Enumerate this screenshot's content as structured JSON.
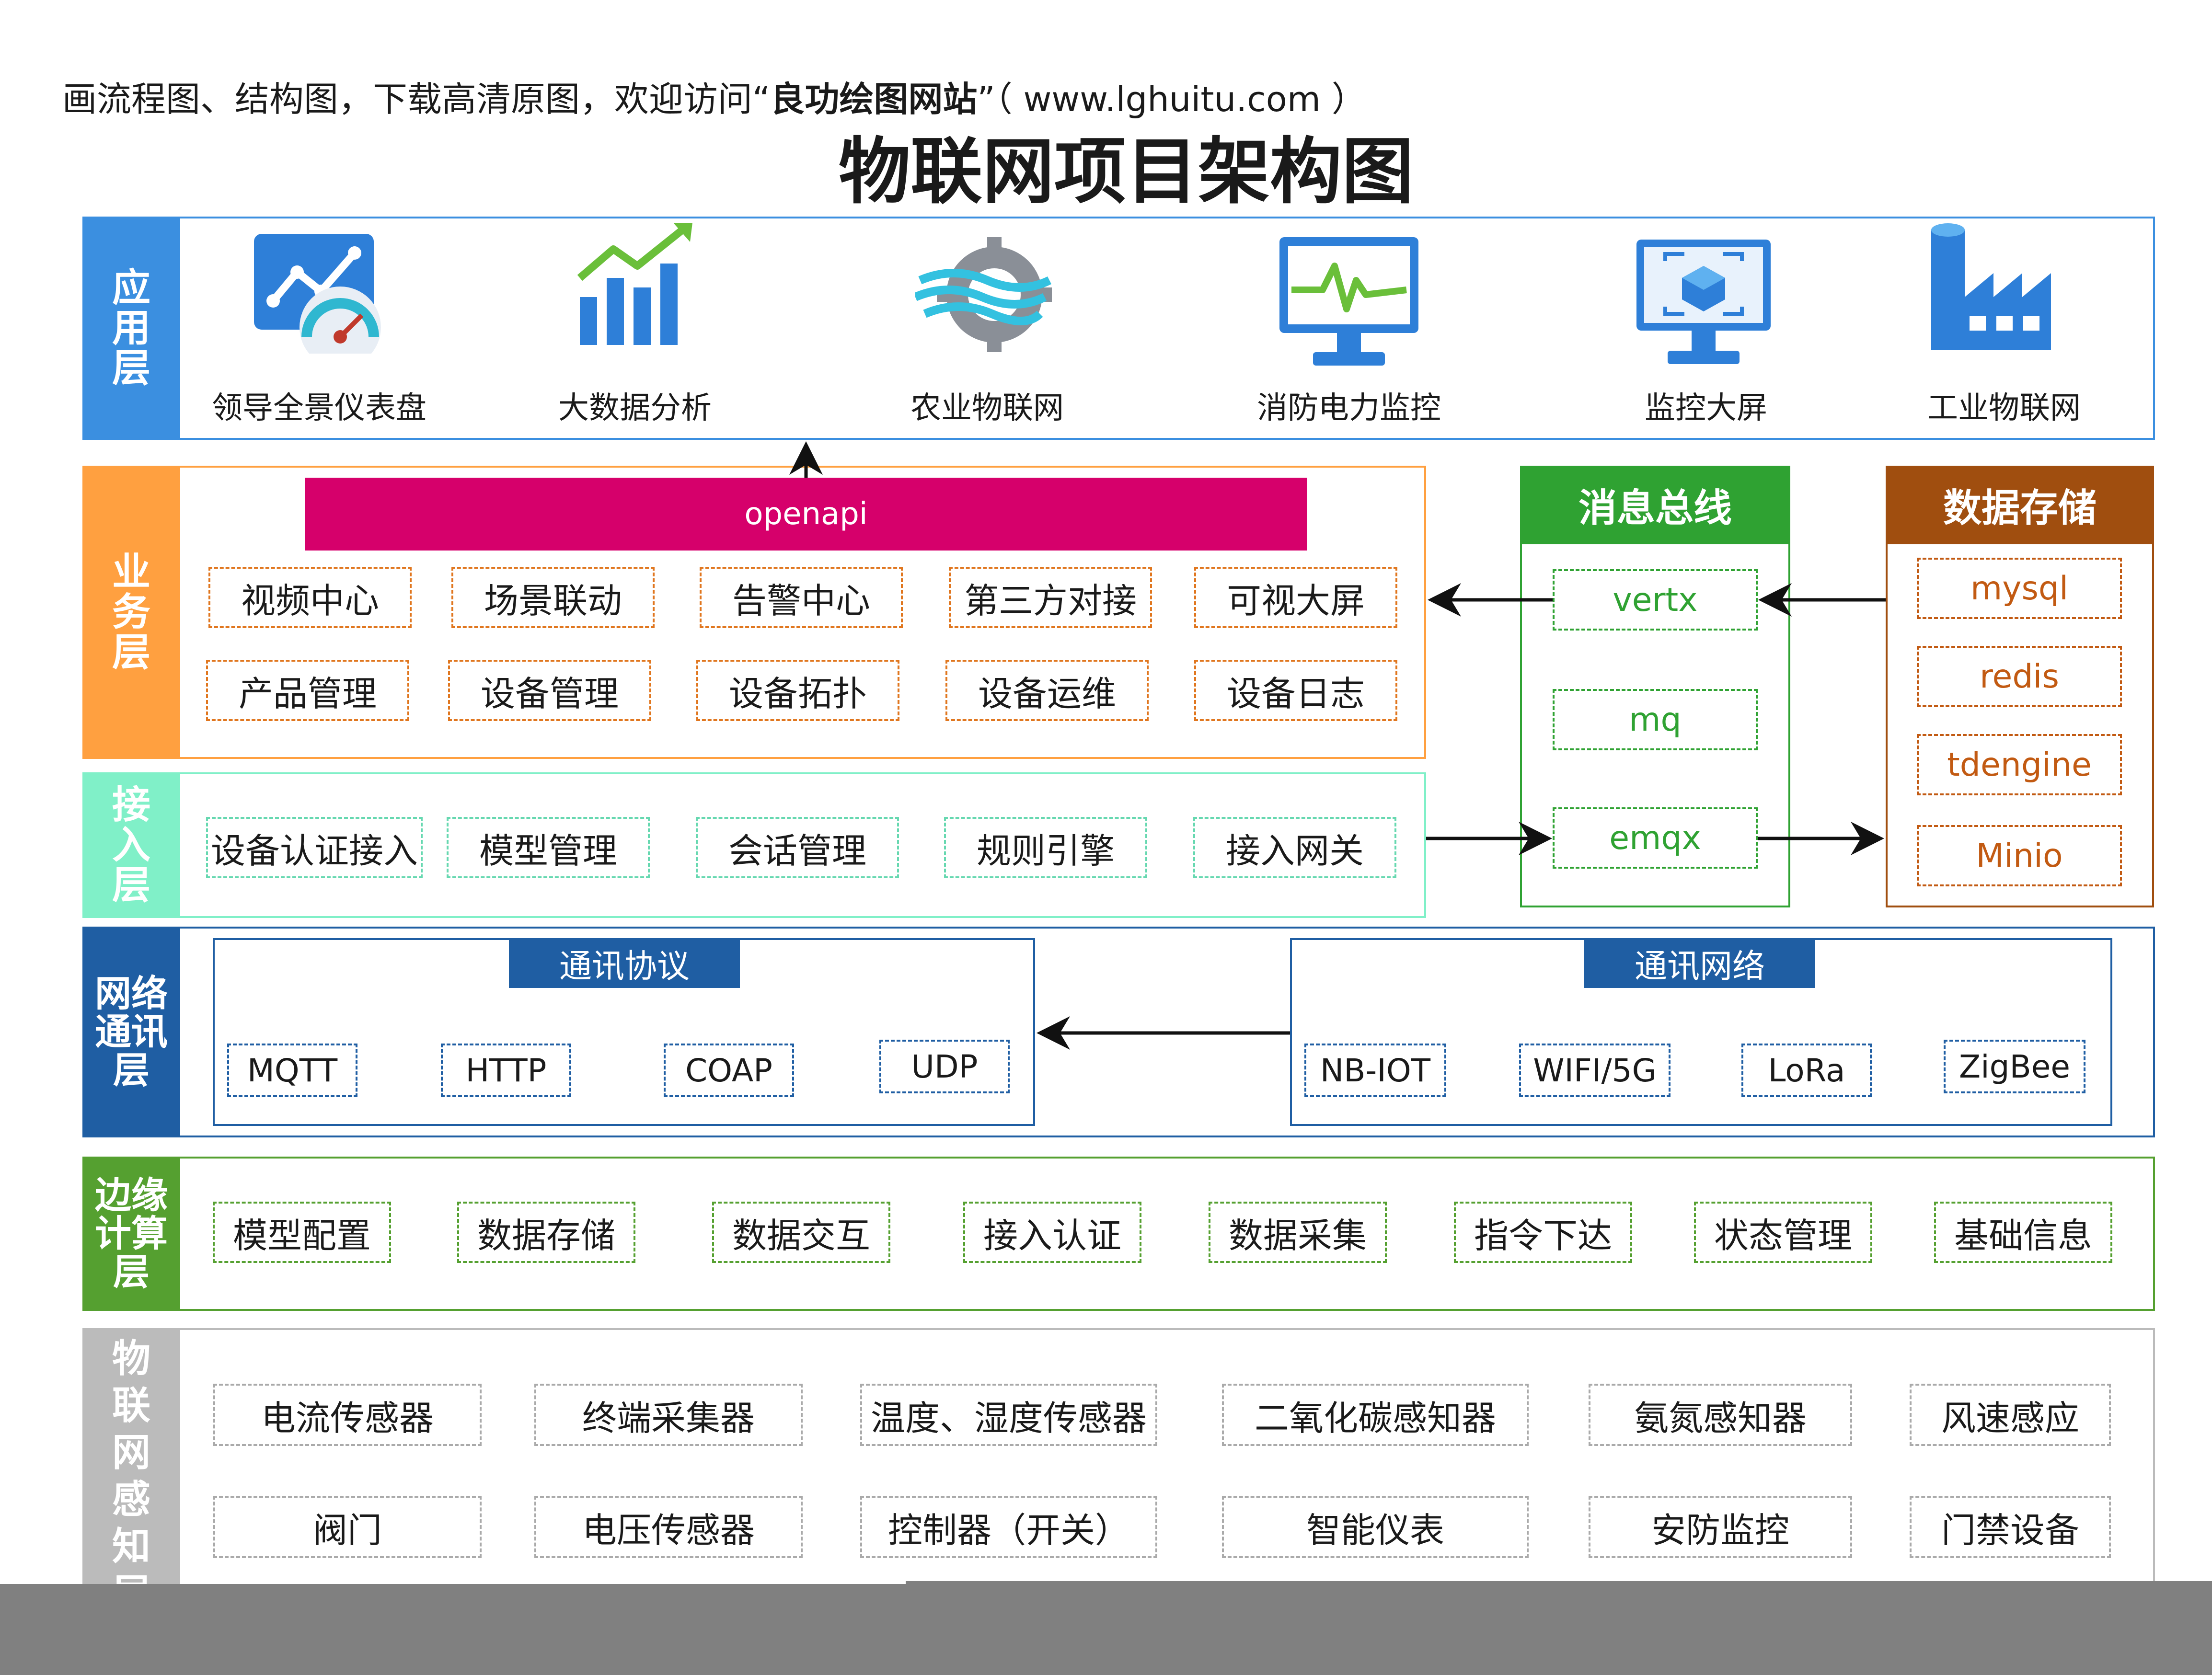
{
  "header": {
    "note_prefix": "画流程图、结构图，下载高清原图，欢迎访问“",
    "note_brand": "良功绘图网站",
    "note_suffix": "”（ www.lghuitu.com ）",
    "title": "物联网项目架构图"
  },
  "colors": {
    "app": "#3b8fe0",
    "business": "#ffa040",
    "access": "#80f0c8",
    "network": "#1f5ea3",
    "edge": "#55a030",
    "perception": "#bbbbbb",
    "openapi": "#d6006b",
    "bus": "#2fa232",
    "storage": "#a04e0f"
  },
  "app_layer": {
    "name": [
      "应",
      "用",
      "层"
    ],
    "items": [
      {
        "label": "领导全景仪表盘",
        "icon": "dashboard-gauge-icon"
      },
      {
        "label": "大数据分析",
        "icon": "bar-chart-trend-icon"
      },
      {
        "label": "农业物联网",
        "icon": "gear-wind-icon"
      },
      {
        "label": "消防电力监控",
        "icon": "monitor-pulse-icon"
      },
      {
        "label": "监控大屏",
        "icon": "monitor-cube-icon"
      },
      {
        "label": "工业物联网",
        "icon": "factory-icon"
      }
    ]
  },
  "business_layer": {
    "name": [
      "业",
      "务",
      "层"
    ],
    "openapi": "openapi",
    "row1": [
      "视频中心",
      "场景联动",
      "告警中心",
      "第三方对接",
      "可视大屏"
    ],
    "row2": [
      "产品管理",
      "设备管理",
      "设备拓扑",
      "设备运维",
      "设备日志"
    ]
  },
  "access_layer": {
    "name": [
      "接",
      "入",
      "层"
    ],
    "items": [
      "设备认证接入",
      "模型管理",
      "会话管理",
      "规则引擎",
      "接入网关"
    ]
  },
  "message_bus": {
    "title": "消息总线",
    "items": [
      "vertx",
      "mq",
      "emqx"
    ]
  },
  "data_storage": {
    "title": "数据存储",
    "items": [
      "mysql",
      "redis",
      "tdengine",
      "Minio"
    ]
  },
  "network_layer": {
    "name": [
      "网络",
      "通讯",
      "层"
    ],
    "protocol_title": "通讯协议",
    "protocols": [
      "MQTT",
      "HTTP",
      "COAP",
      "UDP"
    ],
    "network_title": "通讯网络",
    "networks": [
      "NB-IOT",
      "WIFI/5G",
      "LoRa",
      "ZigBee"
    ]
  },
  "edge_layer": {
    "name": [
      "边缘",
      "计算",
      "层"
    ],
    "items": [
      "模型配置",
      "数据存储",
      "数据交互",
      "接入认证",
      "数据采集",
      "指令下达",
      "状态管理",
      "基础信息"
    ]
  },
  "perception_layer": {
    "name": [
      "物",
      "联",
      "网",
      "感",
      "知",
      "层"
    ],
    "row1": [
      "电流传感器",
      "终端采集器",
      "温度、湿度传感器",
      "二氧化碳感知器",
      "氨氮感知器",
      "风速感应"
    ],
    "row2": [
      "阀门",
      "电压传感器",
      "控制器（开关）",
      "智能仪表",
      "安防监控",
      "门禁设备"
    ]
  }
}
